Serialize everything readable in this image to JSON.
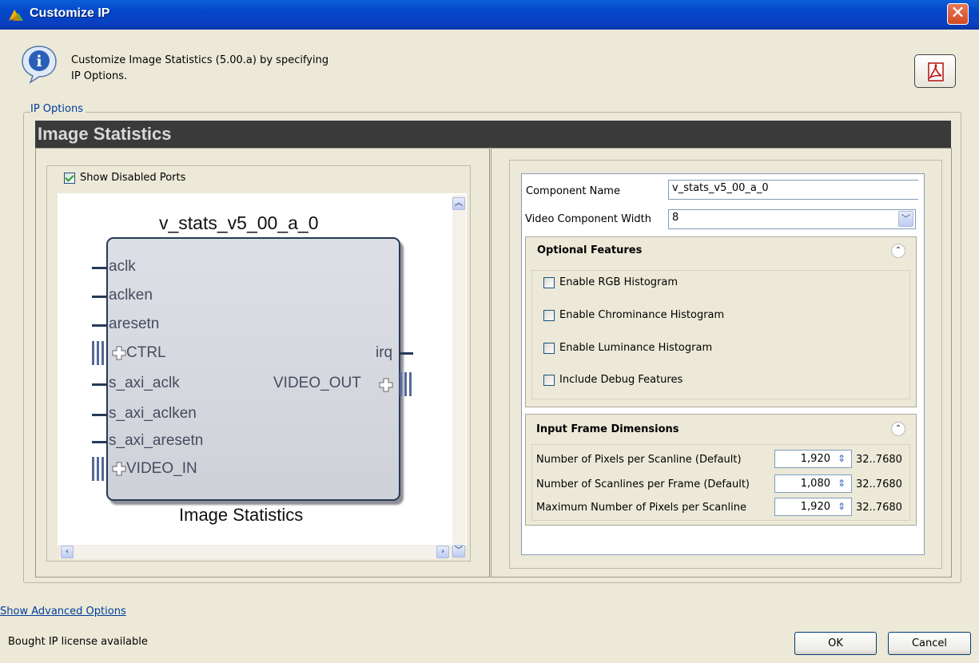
{
  "window": {
    "title": "Customize IP",
    "close_label": "✕"
  },
  "header": {
    "line1": "Customize Image Statistics (5.00.a) by specifying",
    "line2": "IP Options."
  },
  "ip_options_label": "IP Options",
  "banner_title": "Image Statistics",
  "left": {
    "show_disabled_ports": {
      "label": "Show Disabled Ports",
      "checked": true
    },
    "component_title": "v_stats_v5_00_a_0",
    "component_footer": "Image Statistics",
    "ports_left": [
      "aclk",
      "aclken",
      "aresetn",
      "CTRL",
      "s_axi_aclk",
      "s_axi_aclken",
      "s_axi_aresetn",
      "VIDEO_IN"
    ],
    "ports_right": [
      "irq",
      "VIDEO_OUT"
    ]
  },
  "right": {
    "component_name_label": "Component Name",
    "component_name_value": "v_stats_v5_00_a_0",
    "video_width_label": "Video Component Width",
    "video_width_value": "8",
    "optional_features": {
      "title": "Optional Features",
      "options": [
        "Enable RGB Histogram",
        "Enable Chrominance Histogram",
        "Enable Luminance Histogram",
        "Include Debug Features"
      ]
    },
    "input_frame": {
      "title": "Input Frame Dimensions",
      "rows": [
        {
          "label": "Number of Pixels per Scanline (Default)",
          "value": "1,920",
          "range": "32..7680"
        },
        {
          "label": "Number of Scanlines per Frame (Default)",
          "value": "1,080",
          "range": "32..7680"
        },
        {
          "label": "Maximum Number of Pixels per Scanline",
          "value": "1,920",
          "range": "32..7680"
        }
      ]
    }
  },
  "footer": {
    "advanced_link": "Show Advanced Options",
    "status": "Bought IP license available",
    "ok": "OK",
    "cancel": "Cancel"
  }
}
